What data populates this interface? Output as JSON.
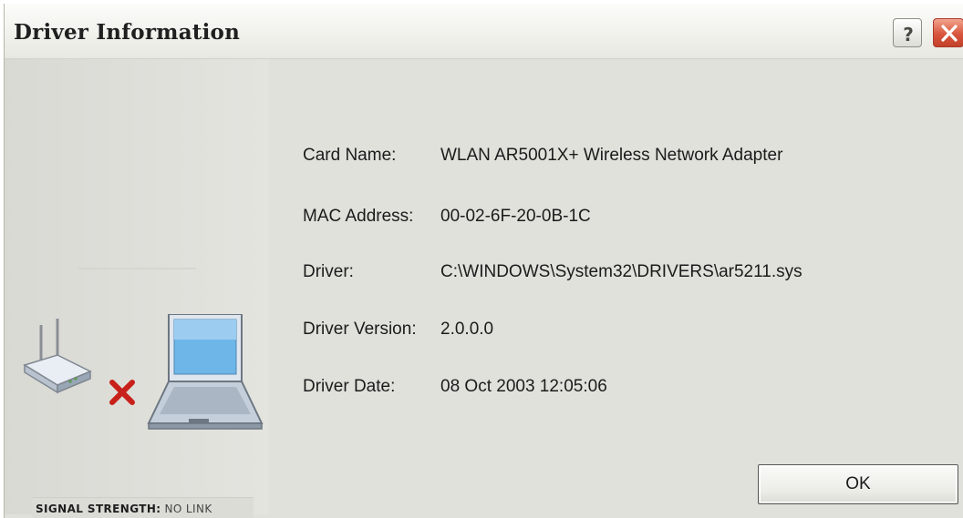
{
  "window": {
    "title": "Driver Information",
    "help_icon": "question-mark-icon",
    "close_icon": "close-x-icon"
  },
  "status": {
    "signal_key": "SIGNAL STRENGTH:",
    "signal_value": "NO LINK",
    "router_icon": "wireless-router-icon",
    "disconnected_icon": "red-x-icon",
    "laptop_icon": "laptop-icon"
  },
  "details": [
    {
      "label": "Card Name:",
      "value": "WLAN AR5001X+ Wireless Network Adapter"
    },
    {
      "label": "MAC Address:",
      "value": "00-02-6F-20-0B-1C"
    },
    {
      "label": "Driver:",
      "value": "C:\\WINDOWS\\System32\\DRIVERS\\ar5211.sys"
    },
    {
      "label": "Driver Version:",
      "value": "2.0.0.0"
    },
    {
      "label": "Driver Date:",
      "value": "08 Oct 2003 12:05:06"
    }
  ],
  "buttons": {
    "ok_label": "OK"
  },
  "colors": {
    "dialog_background": "#e1e1dc",
    "close_button": "#d9553d",
    "disconnected_x": "#c8201a",
    "laptop_screen": "#6fb6e8"
  }
}
